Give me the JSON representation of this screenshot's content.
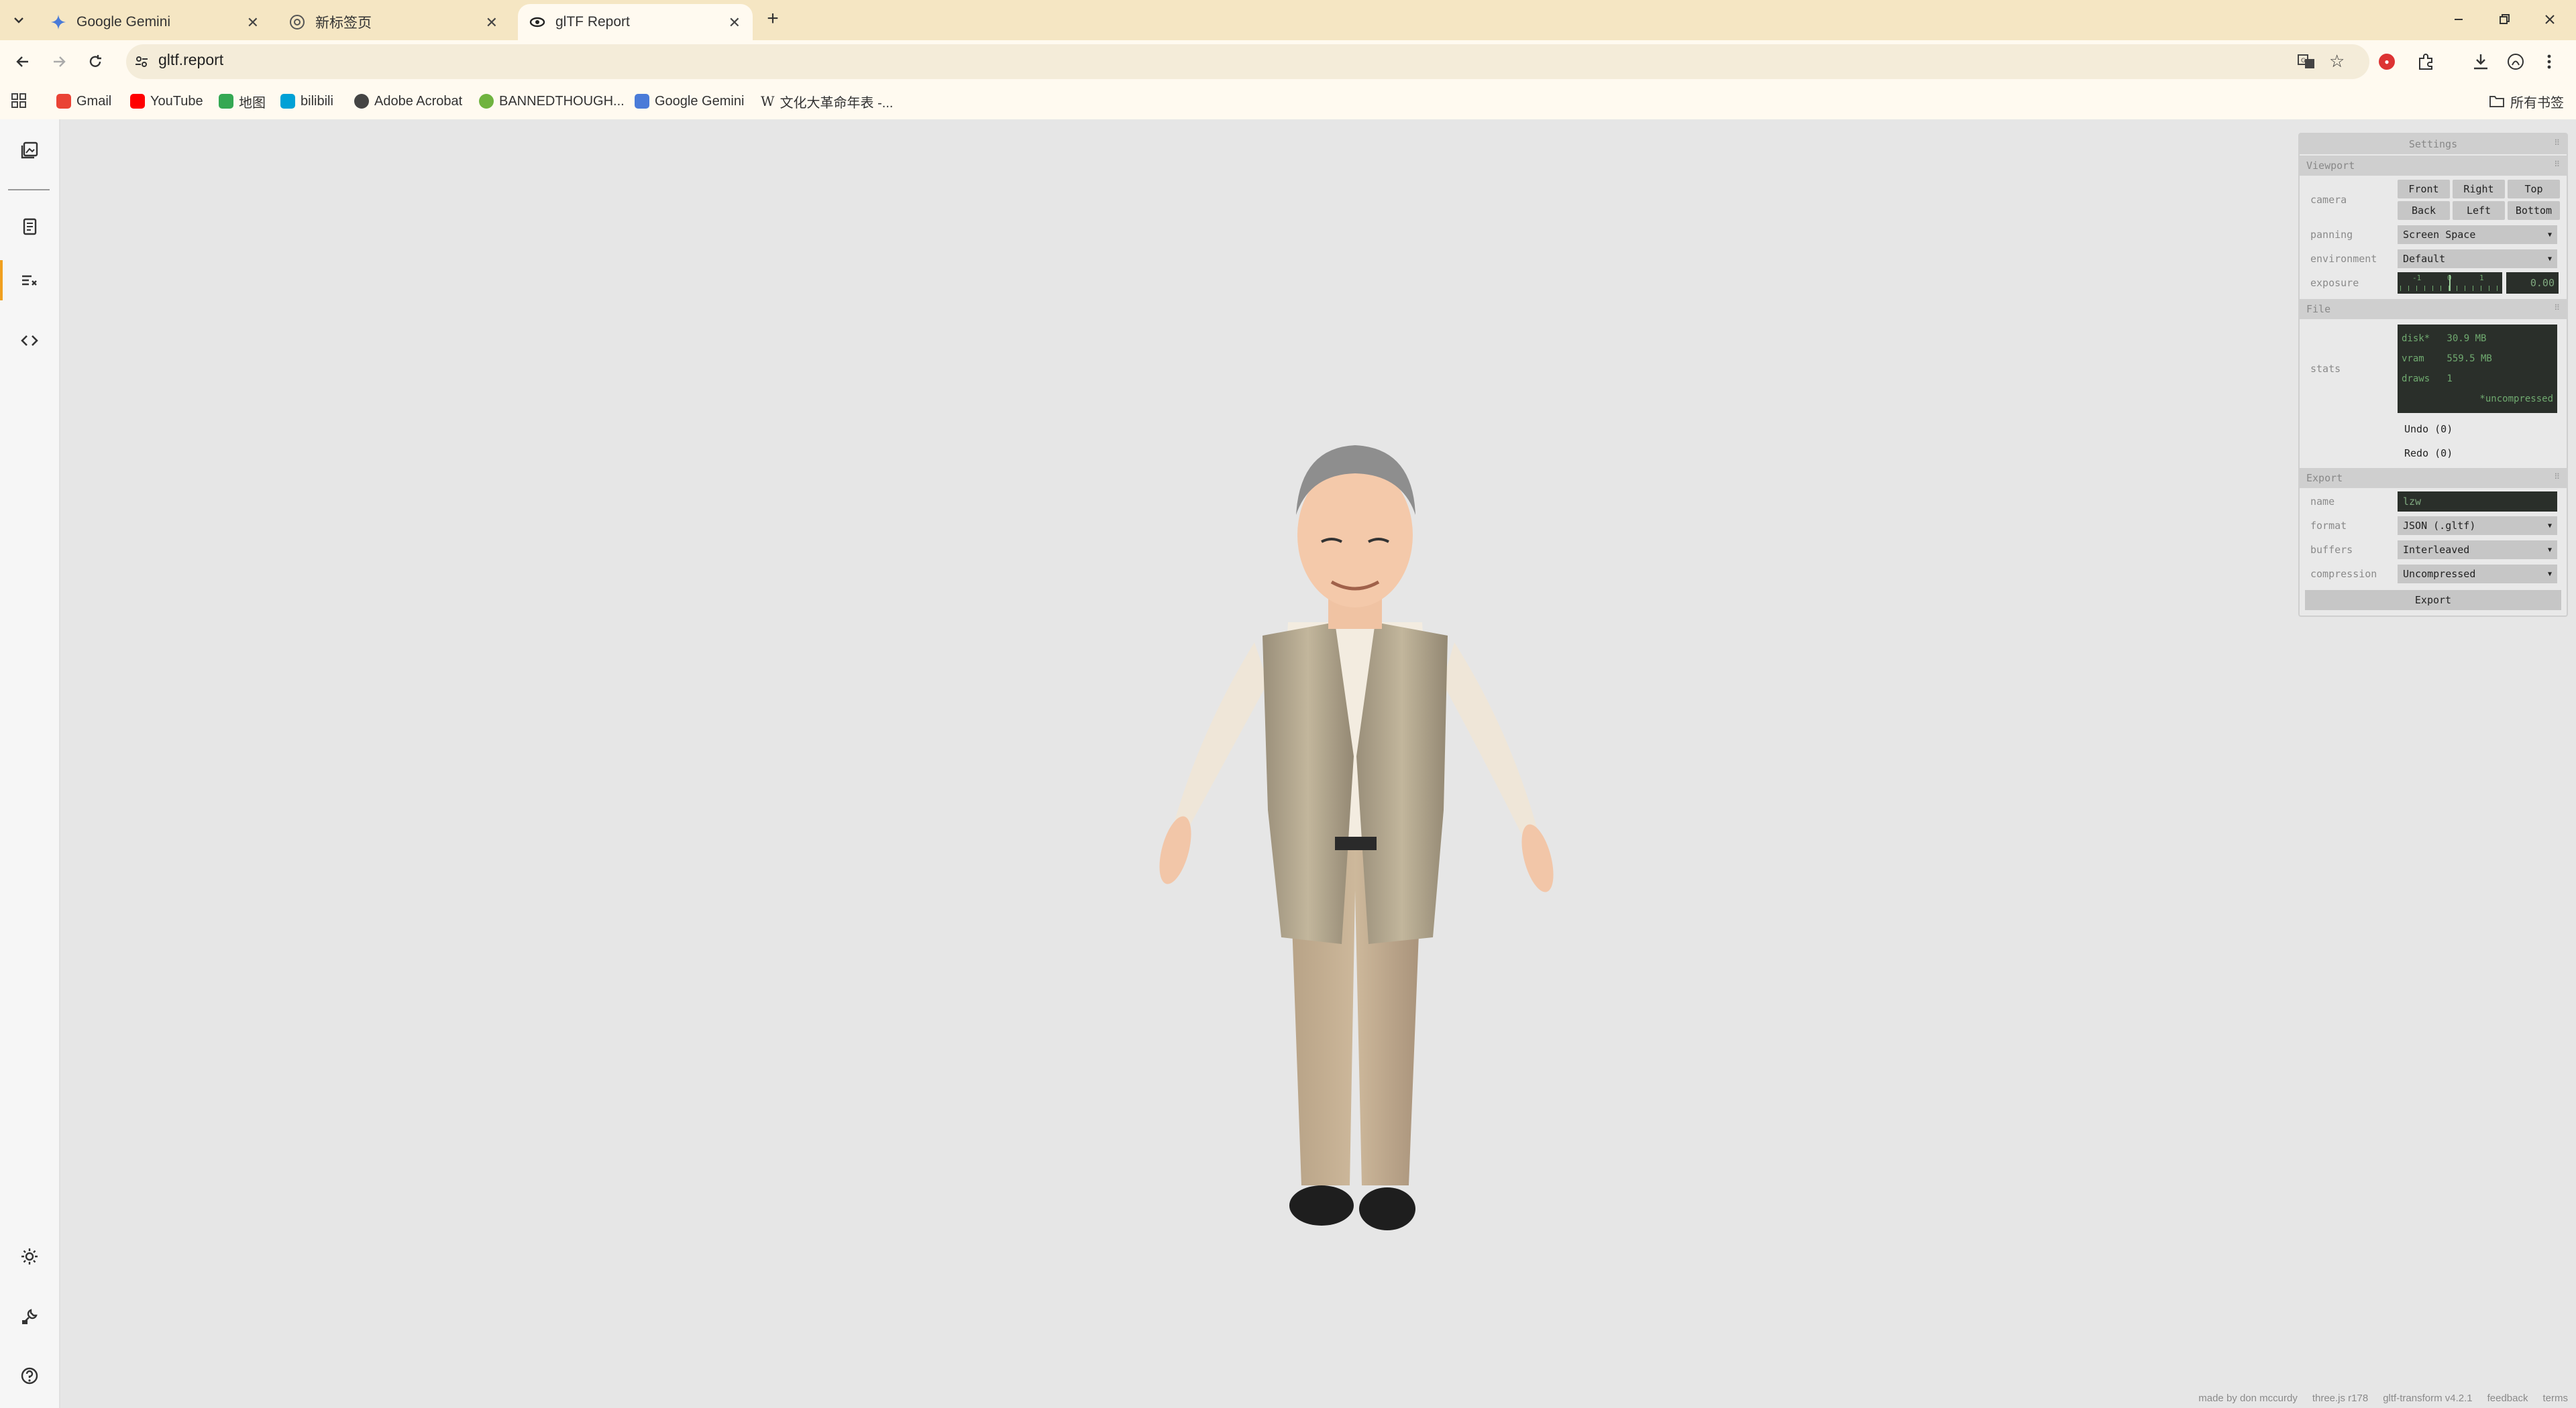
{
  "tabs": [
    {
      "label": "Google Gemini",
      "icon": "gemini-icon"
    },
    {
      "label": "新标签页",
      "icon": "chrome-icon"
    },
    {
      "label": "glTF Report",
      "icon": "gltf-icon"
    }
  ],
  "address": {
    "url": "gltf.report"
  },
  "bookmarks": [
    {
      "label": "Gmail",
      "color": "#ea4335"
    },
    {
      "label": "YouTube",
      "color": "#ff0000"
    },
    {
      "label": "地图",
      "color": "#34a853"
    },
    {
      "label": "bilibili",
      "color": "#00a1d6"
    },
    {
      "label": "Adobe Acrobat",
      "color": "#444444"
    },
    {
      "label": "BANNEDTHOUGH...",
      "color": "#6fb33f"
    },
    {
      "label": "Google Gemini",
      "color": "#4a7bd8"
    },
    {
      "label": "文化大革命年表 -...",
      "color": "#333333"
    }
  ],
  "all_bookmarks": "所有书签",
  "sidebar": {
    "icons": [
      "gallery-icon",
      "document-icon",
      "tune-icon",
      "code-icon",
      "sun-icon",
      "wrench-icon",
      "help-icon"
    ]
  },
  "panel": {
    "title": "Settings",
    "viewport": {
      "header": "Viewport",
      "camera_label": "camera",
      "camera_buttons": [
        "Front",
        "Right",
        "Top",
        "Back",
        "Left",
        "Bottom"
      ],
      "panning_label": "panning",
      "panning_value": "Screen Space",
      "environment_label": "environment",
      "environment_value": "Default",
      "exposure_label": "exposure",
      "exposure_ticks": [
        "-1",
        "0",
        "1"
      ],
      "exposure_value": "0.00"
    },
    "file": {
      "header": "File",
      "stats_label": "stats",
      "disk": "disk*   30.9 MB",
      "vram": "vram    559.5 MB",
      "draws": "draws   1",
      "note": "*uncompressed",
      "undo": "Undo (0)",
      "redo": "Redo (0)"
    },
    "export": {
      "header": "Export",
      "name_label": "name",
      "name_value": "lzw",
      "format_label": "format",
      "format_value": "JSON (.gltf)",
      "buffers_label": "buffers",
      "buffers_value": "Interleaved",
      "compression_label": "compression",
      "compression_value": "Uncompressed",
      "export_button": "Export"
    }
  },
  "footer": {
    "made_by": "made by don mccurdy",
    "threejs": "three.js r178",
    "gltf_transform": "gltf-transform v4.2.1",
    "feedback": "feedback",
    "terms": "terms"
  }
}
